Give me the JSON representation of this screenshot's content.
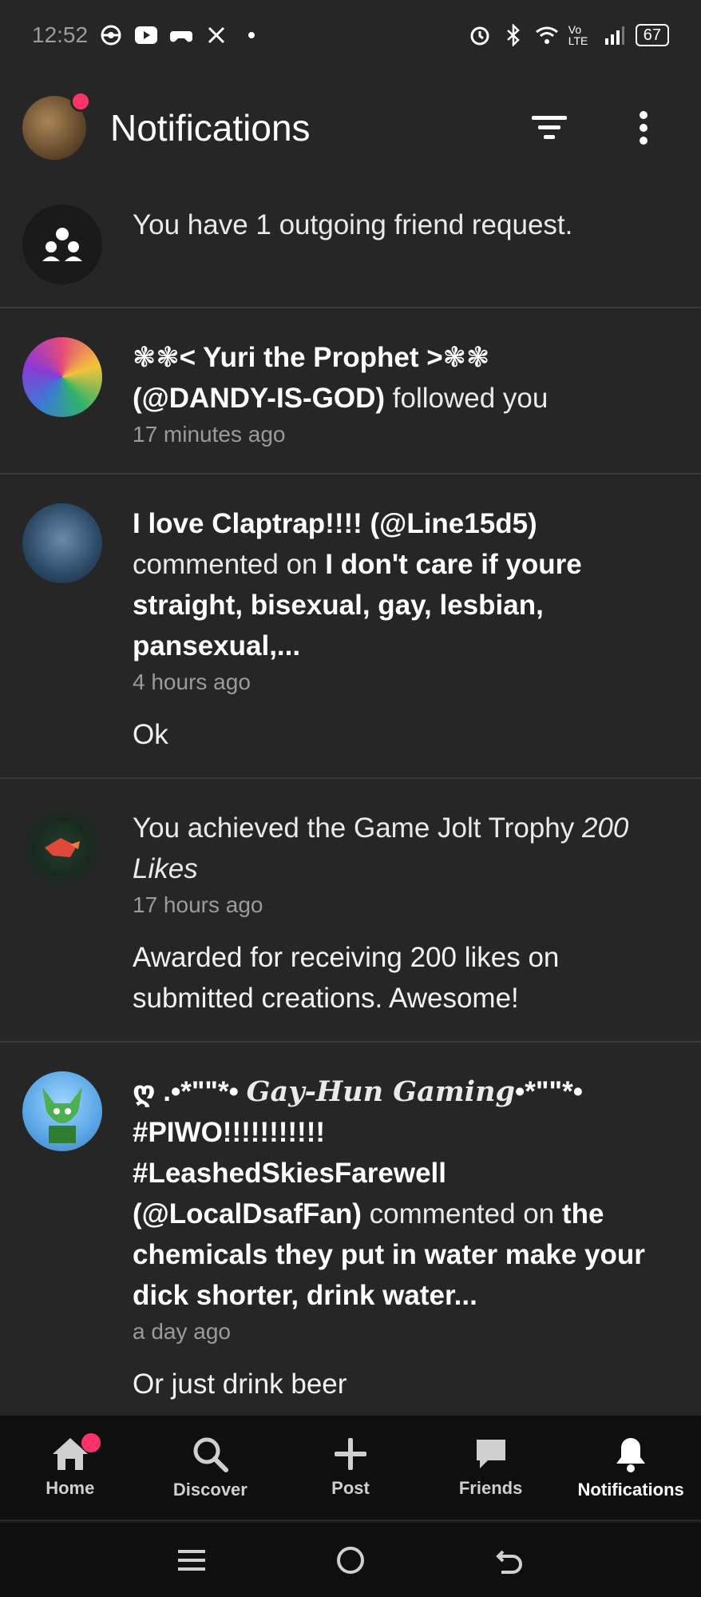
{
  "status_bar": {
    "time": "12:52",
    "battery": "67",
    "network": "Vo LTE"
  },
  "header": {
    "title": "Notifications"
  },
  "notifications": [
    {
      "text": "You have 1 outgoing friend request."
    },
    {
      "name": "❃❃< Yuri the Prophet >❃❃",
      "handle": "(@DANDY-IS-GOD)",
      "action": " followed you",
      "time": "17 minutes ago"
    },
    {
      "name": "I love Claptrap!!!!",
      "handle": "(@Line15d5)",
      "action": " commented on ",
      "target": "I don't care if youre straight, bisexual, gay, lesbian, pansexual,...",
      "time": "4 hours ago",
      "body": "Ok"
    },
    {
      "prefix": "You achieved the Game Jolt Trophy ",
      "trophy": "200 Likes",
      "time": "17 hours ago",
      "body": "Awarded for receiving 200 likes on submitted creations. Awesome!"
    },
    {
      "name_symbol": "ღ .•*\"\"*• ",
      "name_italic": "Gay-Hun Gaming",
      "name_tail": "•*\"\"*•",
      "name_line2": "#PIWO!!!!!!!!!!!",
      "name_line3": "#LeashedSkiesFarewell",
      "handle": "(@LocalDsafFan)",
      "action": " commented on ",
      "target": "the chemicals they put in water make your dick shorter, drink water...",
      "time": "a day ago",
      "body": "Or just drink beer"
    }
  ],
  "bottom_nav": {
    "items": [
      {
        "label": "Home",
        "icon": "home-icon"
      },
      {
        "label": "Discover",
        "icon": "search-icon"
      },
      {
        "label": "Post",
        "icon": "plus-icon"
      },
      {
        "label": "Friends",
        "icon": "chat-icon"
      },
      {
        "label": "Notifications",
        "icon": "bell-icon"
      }
    ]
  },
  "colors": {
    "background": "#262626",
    "accent_dot": "#ff3369",
    "nav_background": "#0f0f0f"
  }
}
